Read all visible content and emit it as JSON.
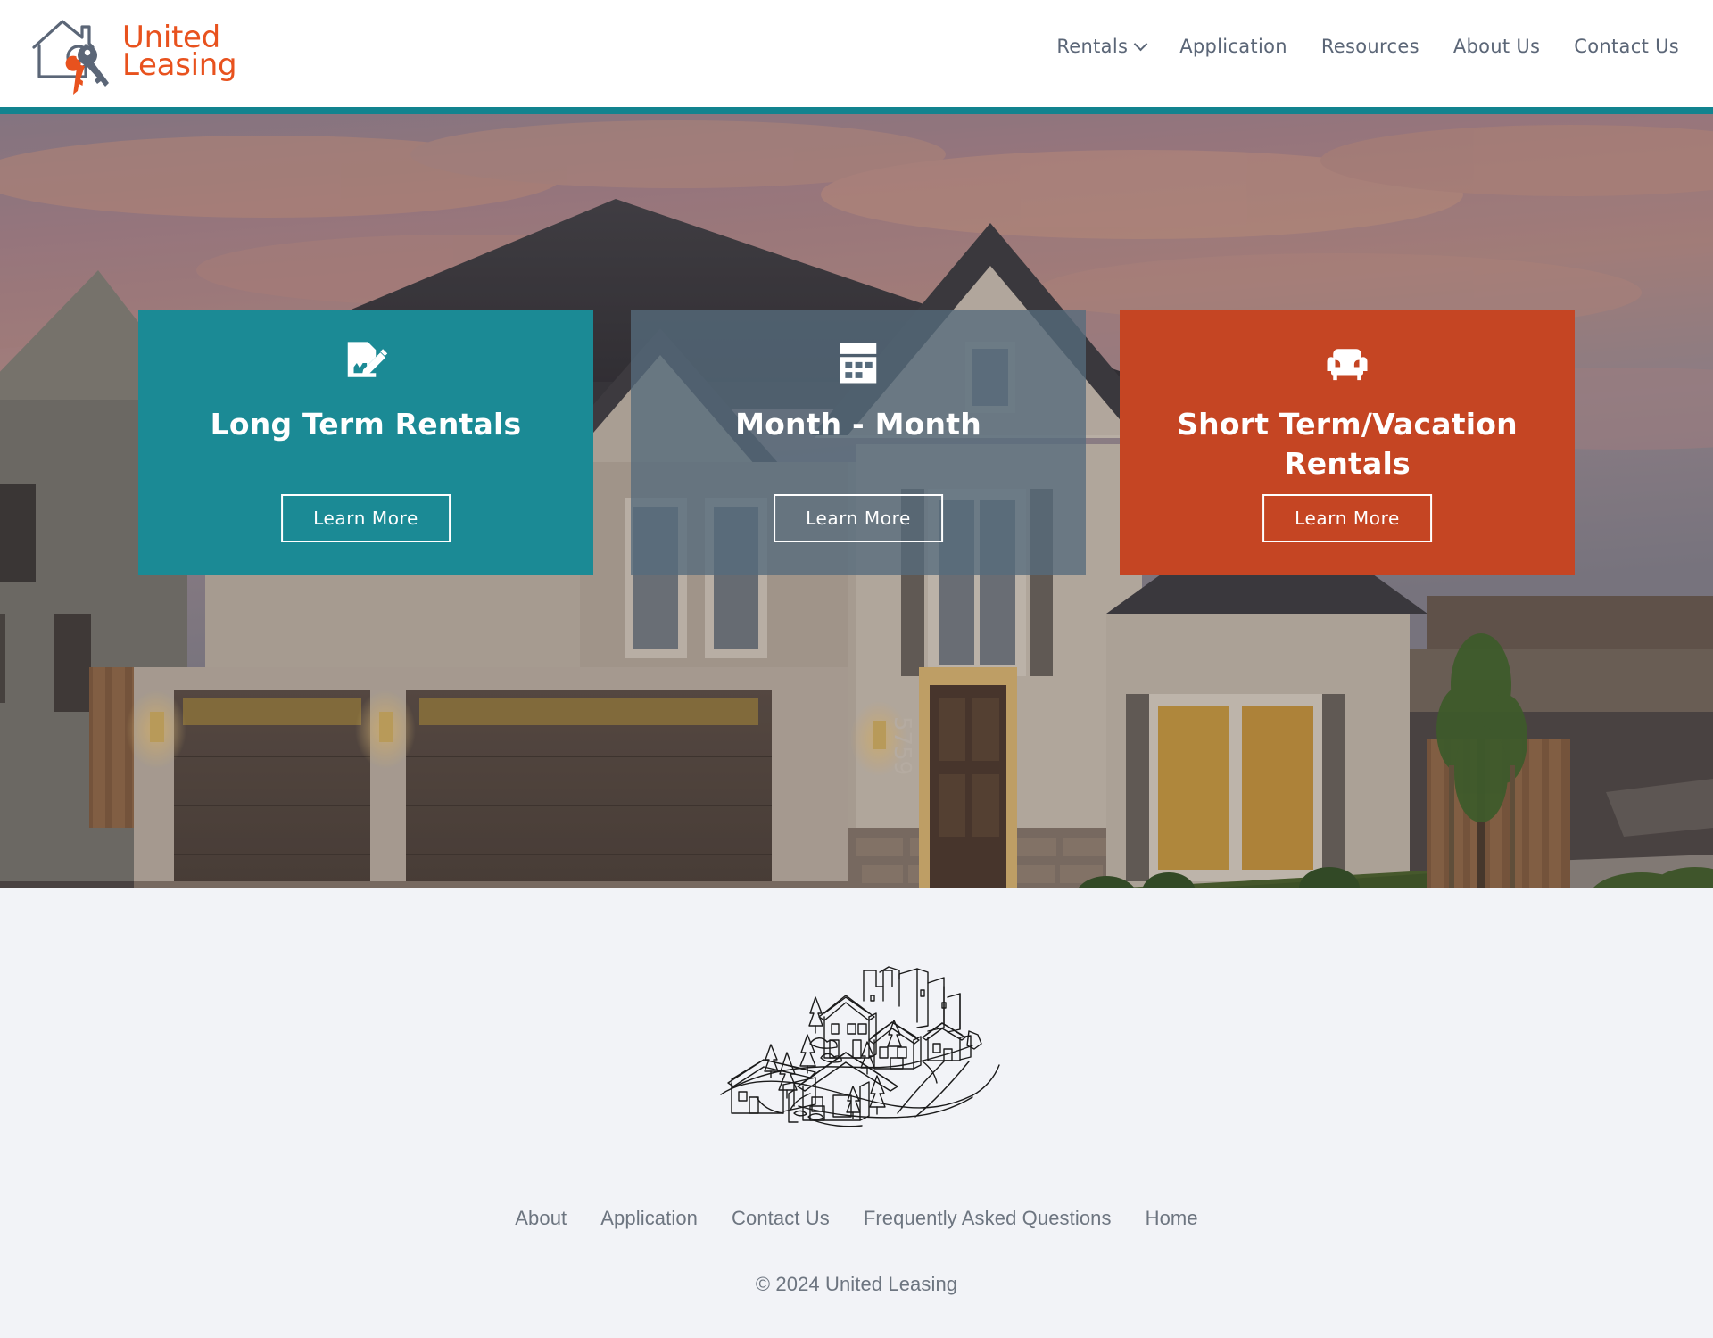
{
  "site": {
    "title": "United Leasing",
    "logo": {
      "icon": "house-with-keys-icon",
      "line1": "United",
      "line2": "Leasing"
    },
    "accent_teal": "#12838f",
    "accent_orange": "#e8521e"
  },
  "nav": {
    "items": [
      {
        "label": "Rentals",
        "has_dropdown": true
      },
      {
        "label": "Application",
        "has_dropdown": false
      },
      {
        "label": "Resources",
        "has_dropdown": false
      },
      {
        "label": "About Us",
        "has_dropdown": false
      },
      {
        "label": "Contact Us",
        "has_dropdown": false
      }
    ]
  },
  "hero": {
    "alt": "Two-story suburban home at dusk with double garage and wet driveway",
    "cards": [
      {
        "icon": "document-signature-icon",
        "title": "Long Term Rentals",
        "button": "Learn More",
        "color": "#1b8a95"
      },
      {
        "icon": "calendar-icon",
        "title": "Month - Month",
        "button": "Learn More",
        "color": "#566b7c"
      },
      {
        "icon": "sofa-icon",
        "title": "Short Term/Vacation Rentals",
        "button": "Learn More",
        "color": "#c54523"
      }
    ]
  },
  "footer": {
    "illustration": "neighborhood-sketch-icon",
    "links": [
      {
        "label": "About"
      },
      {
        "label": "Application"
      },
      {
        "label": "Contact Us"
      },
      {
        "label": "Frequently Asked Questions"
      },
      {
        "label": "Home"
      }
    ],
    "copyright": "© 2024 United Leasing"
  }
}
